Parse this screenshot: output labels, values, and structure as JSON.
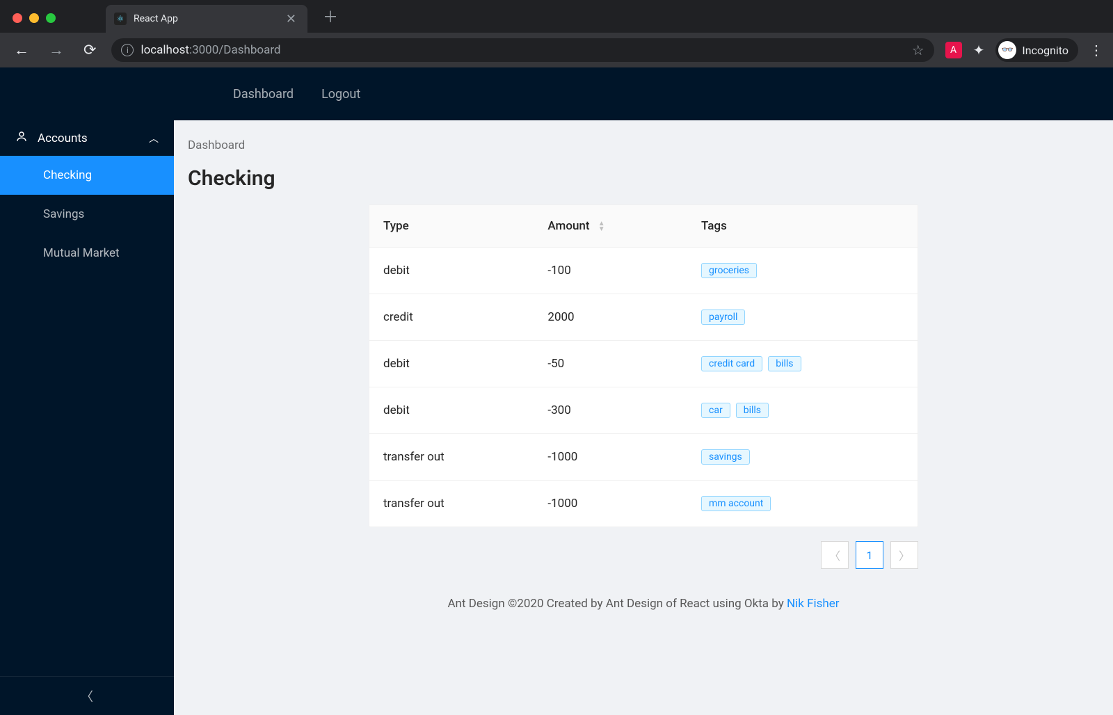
{
  "browser": {
    "tab_title": "React App",
    "url_host": "localhost",
    "url_port_path": ":3000/Dashboard",
    "incognito_label": "Incognito"
  },
  "topnav": {
    "items": [
      {
        "label": "Dashboard"
      },
      {
        "label": "Logout"
      }
    ]
  },
  "sidebar": {
    "group_label": "Accounts",
    "items": [
      {
        "label": "Checking",
        "active": true
      },
      {
        "label": "Savings",
        "active": false
      },
      {
        "label": "Mutual Market",
        "active": false
      }
    ]
  },
  "content": {
    "breadcrumb": "Dashboard",
    "page_title": "Checking",
    "columns": {
      "type": "Type",
      "amount": "Amount",
      "tags": "Tags"
    },
    "rows": [
      {
        "type": "debit",
        "amount": "-100",
        "tags": [
          "groceries"
        ]
      },
      {
        "type": "credit",
        "amount": "2000",
        "tags": [
          "payroll"
        ]
      },
      {
        "type": "debit",
        "amount": "-50",
        "tags": [
          "credit card",
          "bills"
        ]
      },
      {
        "type": "debit",
        "amount": "-300",
        "tags": [
          "car",
          "bills"
        ]
      },
      {
        "type": "transfer out",
        "amount": "-1000",
        "tags": [
          "savings"
        ]
      },
      {
        "type": "transfer out",
        "amount": "-1000",
        "tags": [
          "mm account"
        ]
      }
    ],
    "pagination": {
      "current": "1"
    },
    "footer_prefix": "Ant Design ©2020 Created by Ant Design of React using Okta by ",
    "footer_link": "Nik Fisher"
  }
}
